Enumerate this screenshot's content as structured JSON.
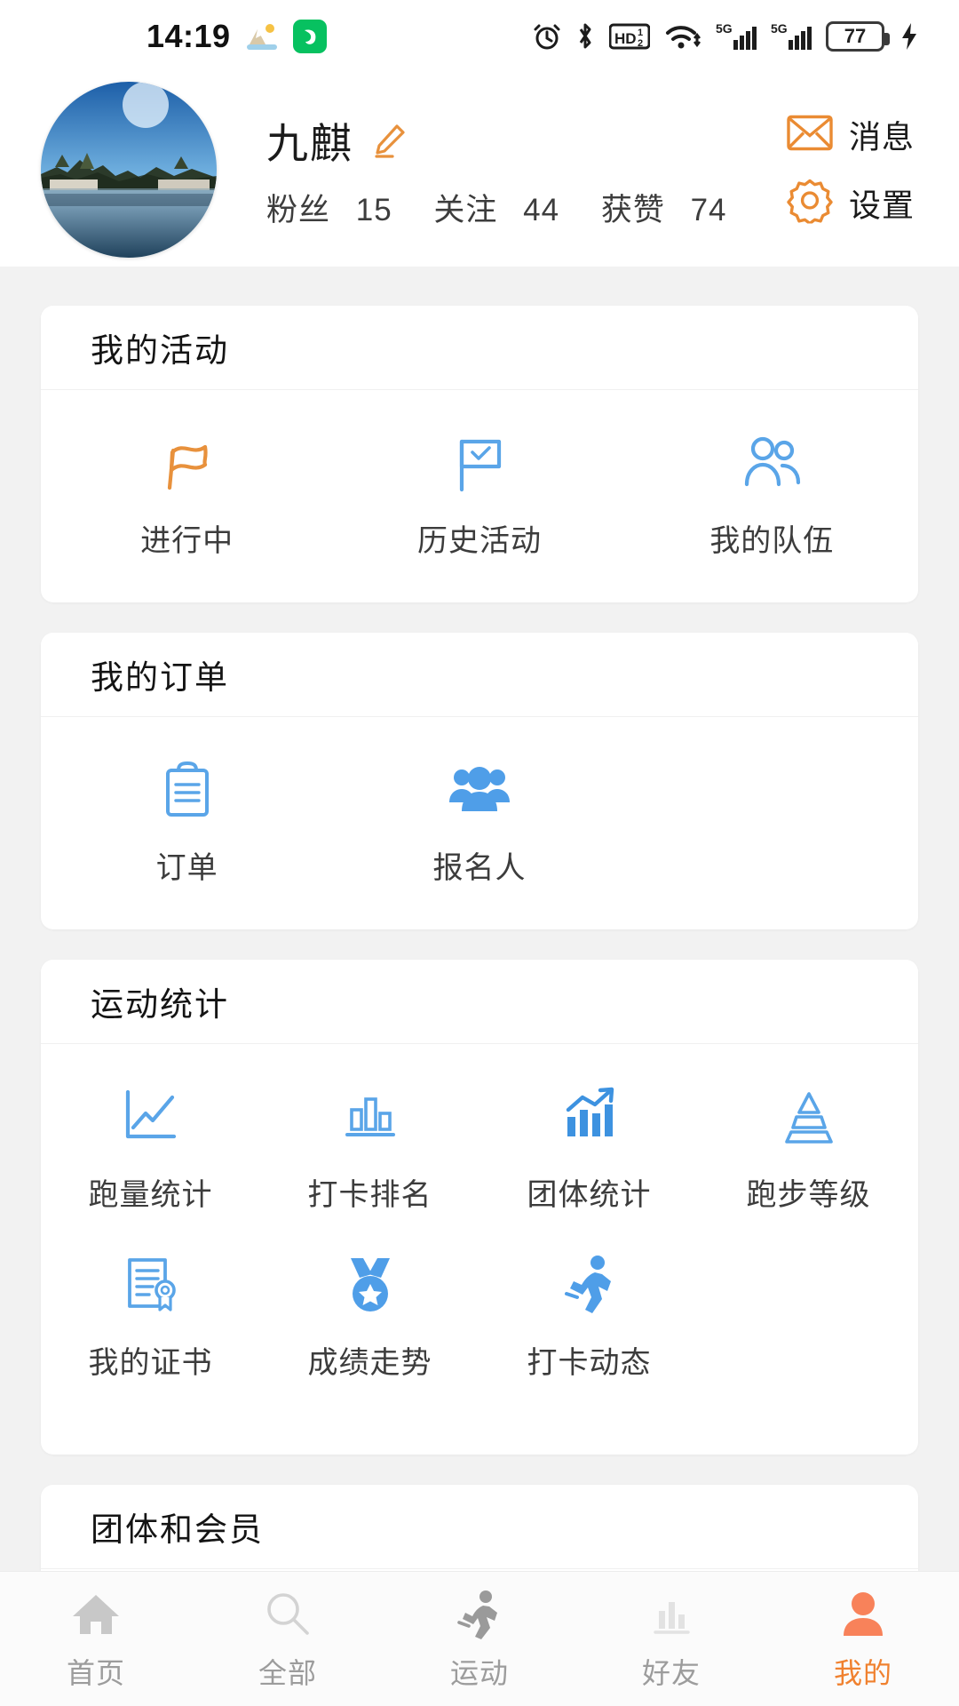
{
  "status_bar": {
    "time": "14:19",
    "battery_level": "77",
    "icons": [
      "weather-icon",
      "green-app-icon",
      "alarm-icon",
      "bluetooth-icon",
      "hd-voice-icon",
      "wifi-icon",
      "signal-5g-1-icon",
      "signal-5g-2-icon",
      "battery-icon",
      "charging-bolt-icon"
    ]
  },
  "profile": {
    "avatar_alt": "river-landscape-avatar",
    "name": "九麒",
    "edit_icon": "pencil-icon",
    "stats": [
      {
        "label": "粉丝",
        "value": "15"
      },
      {
        "label": "关注",
        "value": "44"
      },
      {
        "label": "获赞",
        "value": "74"
      }
    ],
    "actions": [
      {
        "icon": "envelope-icon",
        "label": "消息"
      },
      {
        "icon": "gear-icon",
        "label": "设置"
      }
    ]
  },
  "sections": [
    {
      "title": "我的活动",
      "items": [
        {
          "icon": "flag-wave-icon",
          "label": "进行中"
        },
        {
          "icon": "flag-check-icon",
          "label": "历史活动"
        },
        {
          "icon": "people-outline-icon",
          "label": "我的队伍"
        }
      ]
    },
    {
      "title": "我的订单",
      "items": [
        {
          "icon": "clipboard-icon",
          "label": "订单"
        },
        {
          "icon": "people-filled-icon",
          "label": "报名人"
        }
      ]
    },
    {
      "title": "运动统计",
      "items": [
        {
          "icon": "line-chart-icon",
          "label": "跑量统计"
        },
        {
          "icon": "bar-chart-outline-icon",
          "label": "打卡排名"
        },
        {
          "icon": "bar-chart-arrow-icon",
          "label": "团体统计"
        },
        {
          "icon": "pyramid-icon",
          "label": "跑步等级"
        },
        {
          "icon": "certificate-icon",
          "label": "我的证书"
        },
        {
          "icon": "medal-star-icon",
          "label": "成绩走势"
        },
        {
          "icon": "runner-icon",
          "label": "打卡动态"
        }
      ]
    },
    {
      "title": "团体和会员",
      "items": []
    }
  ],
  "tabbar": {
    "tabs": [
      {
        "icon": "home-icon",
        "label": "首页",
        "active": false
      },
      {
        "icon": "search-icon",
        "label": "全部",
        "active": false
      },
      {
        "icon": "runner-icon",
        "label": "运动",
        "active": false
      },
      {
        "icon": "bar-chart-icon",
        "label": "好友",
        "active": false
      },
      {
        "icon": "person-icon",
        "label": "我的",
        "active": true
      }
    ]
  },
  "colors": {
    "accent_orange": "#f0812f",
    "icon_blue": "#5ba4e6",
    "icon_blue_dark": "#3d92e0",
    "text_dark": "#1b1b1b",
    "text_gray": "#3c3c3c",
    "page_bg": "#f2f2f2"
  }
}
